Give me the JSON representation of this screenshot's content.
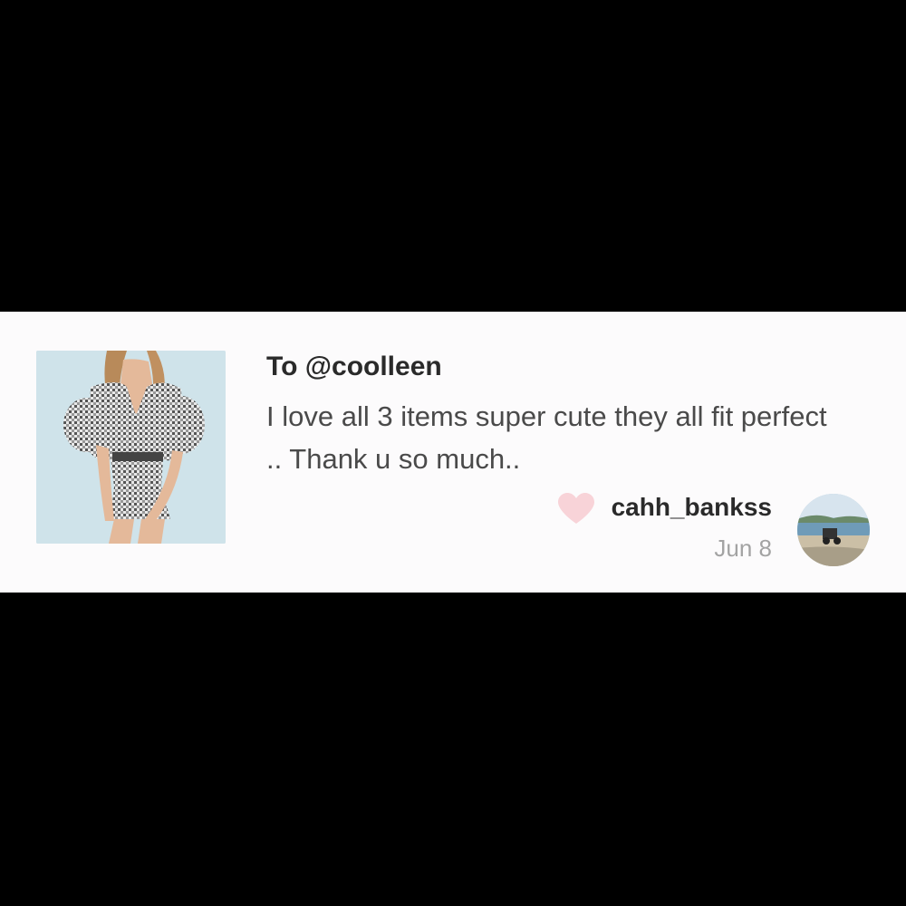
{
  "review": {
    "recipient": "To @coolleen",
    "text": "I love all 3 items super cute they all fit perfect .. Thank u so much..",
    "username": "cahh_bankss",
    "date": "Jun 8",
    "liked": true
  },
  "icons": {
    "like": "heart-icon",
    "product_image": "checkered-dress-photo",
    "avatar": "beach-photo-avatar"
  },
  "colors": {
    "heart": "#f8d3d8",
    "card_background": "#fcfbfc",
    "frame_background": "#000000"
  }
}
